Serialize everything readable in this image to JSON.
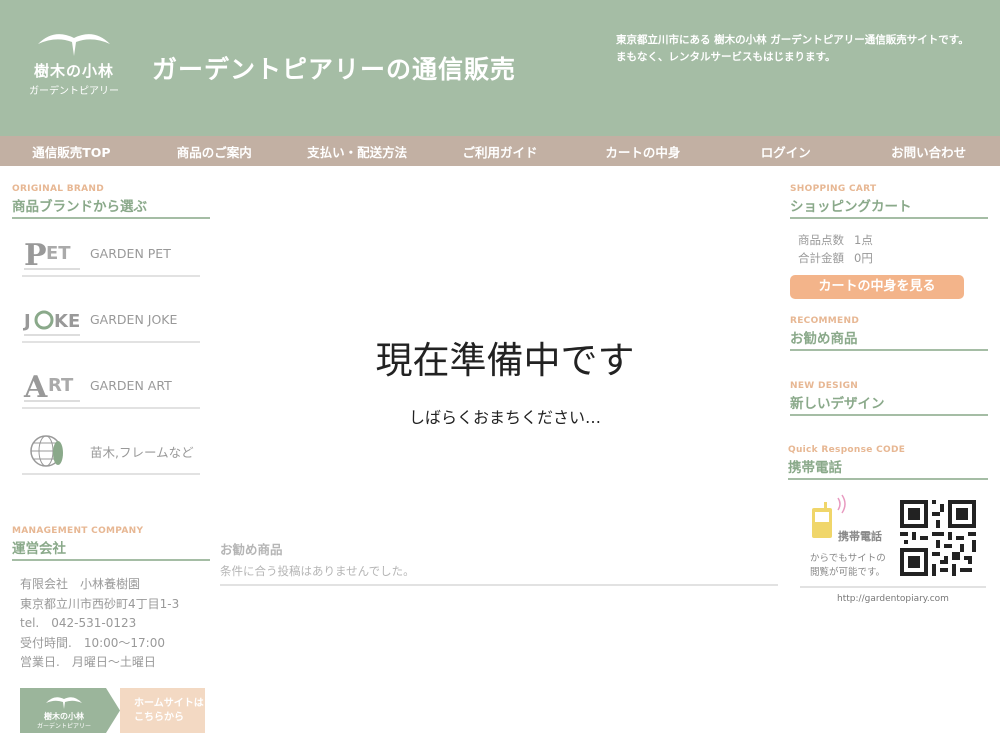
{
  "header": {
    "logo_line1": "樹木の小林",
    "logo_line2": "ガーデントピアリー",
    "title": "ガーデントピアリーの通信販売",
    "description": "東京都立川市にある 樹木の小林 ガーデントピアリー通信販売サイトです。まもなく、レンタルサービスもはじまります。"
  },
  "nav": [
    {
      "label": "通信販売TOP"
    },
    {
      "label": "商品のご案内"
    },
    {
      "label": "支払い・配送方法"
    },
    {
      "label": "ご利用ガイド"
    },
    {
      "label": "カートの中身"
    },
    {
      "label": "ログイン"
    },
    {
      "label": "お問い合わせ"
    }
  ],
  "left": {
    "brand_en": "ORIGINAL BRAND",
    "brand_jp": "商品ブランドから選ぶ",
    "brands": [
      {
        "name": "GARDEN PET",
        "icon": "pet-logo-icon"
      },
      {
        "name": "GARDEN JOKE",
        "icon": "joke-logo-icon"
      },
      {
        "name": "GARDEN ART",
        "icon": "art-logo-icon"
      },
      {
        "name": "苗木,フレームなど",
        "icon": "globe-frame-icon"
      }
    ],
    "company_en": "MANAGEMENT COMPANY",
    "company_jp": "運営会社",
    "company_lines": [
      "有限会社　小林養樹園",
      "東京都立川市西砂町4丁目1-3",
      "tel.　042-531-0123",
      "受付時間.　10:00〜17:00",
      "営業日.　月曜日〜土曜日"
    ],
    "home_banner": {
      "logo_line1": "樹木の小林",
      "logo_line2": "ガーデントピアリー",
      "text_line1": "ホームサイトは",
      "text_line2": "こちらから"
    }
  },
  "main": {
    "maintenance_title": "現在準備中です",
    "maintenance_sub": "しばらくおまちください…",
    "recommend_title": "お勧め商品",
    "recommend_empty": "条件に合う投稿はありませんでした。"
  },
  "right": {
    "cart_en": "SHOPPING CART",
    "cart_jp": "ショッピングカート",
    "cart_count_label": "商品点数",
    "cart_count_value": "1点",
    "cart_total_label": "合計金額",
    "cart_total_value": "0円",
    "cart_button": "カートの中身を見る",
    "recommend_en": "RECOMMEND",
    "recommend_jp": "お勧め商品",
    "design_en": "NEW DESIGN",
    "design_jp": "新しいデザイン",
    "mobile_en": "Quick Response CODE",
    "mobile_jp": "携帯電話",
    "mobile_label": "携帯電話",
    "mobile_text1": "からでもサイトの",
    "mobile_text2": "閲覧が可能です。",
    "url": "http://gardentopiary.com"
  },
  "colors": {
    "header_bg": "#a5bda5",
    "nav_bg": "#c2b0a3",
    "accent_green": "#8aa98a",
    "accent_orange": "#f3b48a"
  }
}
